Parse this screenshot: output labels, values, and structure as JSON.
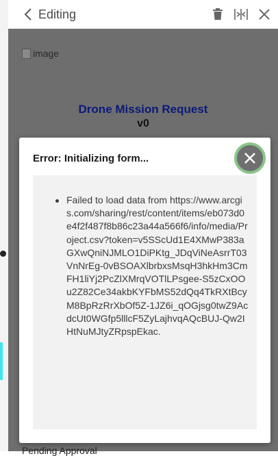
{
  "header": {
    "title": "Editing"
  },
  "content": {
    "image_alt": "image",
    "form_title": "Drone Mission Request",
    "form_version": "v0",
    "pending_label": "Pending Approval"
  },
  "modal": {
    "title": "Error: Initializing form...",
    "errors": [
      "Failed to load data from https://www.arcgis.com/sharing/rest/content/items/eb073d0e4f2f487f8b86c23a44a566f6/info/media/Project.csv?token=v5SScUd1E4XMwP383aGXwQniNJMLO1DiPKtg_JDqViNeAsrrT03VnNrEg-0vBSOAXlbrbxsMsqH3hkHm3CmFH1liYj2PcZlXMrqVOTlLPsgee-S5zCxOOu2Z82Ce34akbKYFbMS52dQq4TkRXtBcyM8BpRzRrXbOf5Z-1JZ6i_qOGjsg0twZ9AcdcUt0WGfp5lllcF5ZyLajhvqAQcBUJ-Qw2IHtNuMJtyZRpspEkac."
    ]
  },
  "colors": {
    "title_blue": "#0a1a7a",
    "close_ring": "#8bc48b",
    "overlay": "#6e6e6e"
  },
  "icons": {
    "back": "chevron-left-icon",
    "delete": "trash-icon",
    "split": "split-icon",
    "close": "close-icon",
    "modal_close": "close-circle-icon"
  }
}
